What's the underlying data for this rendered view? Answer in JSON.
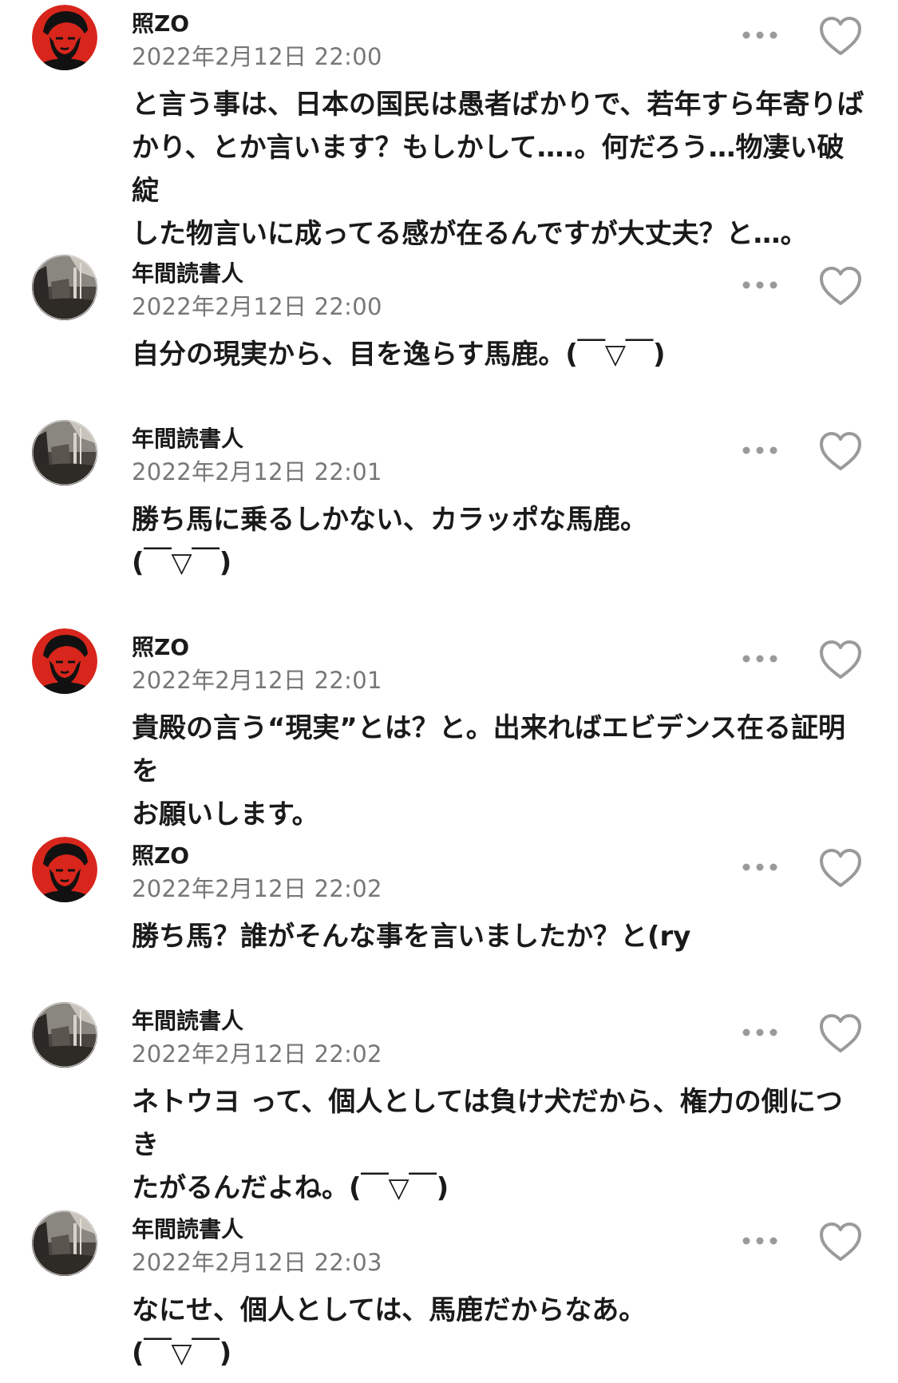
{
  "colors": {
    "text": "#1a1a1a",
    "timestamp": "#777777",
    "icon": "#9a9a9a",
    "avatar_red": "#d8261c"
  },
  "comments": [
    {
      "avatar": "che-portrait-avatar",
      "user": "照ZO",
      "time": "2022年2月12日 22:00",
      "lines": [
        "と言う事は、日本の国民は愚者ばかりで、若年すら年寄りば",
        "かり、とか言います？もしかして….。何だろう…物凄い破綻",
        "した物言いに成ってる感が在るんですが大丈夫？と…。"
      ]
    },
    {
      "avatar": "street-photo-avatar",
      "user": "年間読書人",
      "time": "2022年2月12日 22:00",
      "lines": [
        "自分の現実から、目を逸らす馬鹿。(￣▽￣)"
      ]
    },
    {
      "avatar": "street-photo-avatar",
      "user": "年間読書人",
      "time": "2022年2月12日 22:01",
      "lines": [
        "勝ち馬に乗るしかない、カラッポな馬鹿。",
        "(￣▽￣)"
      ]
    },
    {
      "avatar": "che-portrait-avatar",
      "user": "照ZO",
      "time": "2022年2月12日 22:01",
      "lines": [
        "貴殿の言う“現実”とは？と。出来ればエビデンス在る証明を",
        "お願いします。"
      ]
    },
    {
      "avatar": "che-portrait-avatar",
      "user": "照ZO",
      "time": "2022年2月12日 22:02",
      "lines": [
        "勝ち馬？誰がそんな事を言いましたか？と(ry"
      ]
    },
    {
      "avatar": "street-photo-avatar",
      "user": "年間読書人",
      "time": "2022年2月12日 22:02",
      "lines": [
        "ネトウヨ って、個人としては負け犬だから、権力の側につき",
        "たがるんだよね。(￣▽￣)"
      ]
    },
    {
      "avatar": "street-photo-avatar",
      "user": "年間読書人",
      "time": "2022年2月12日 22:03",
      "lines": [
        "なにせ、個人としては、馬鹿だからなあ。",
        "(￣▽￣)"
      ]
    }
  ]
}
